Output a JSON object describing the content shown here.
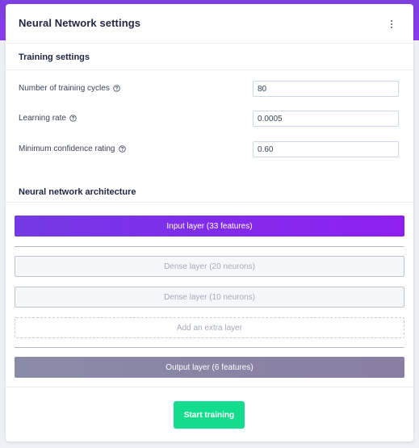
{
  "header": {
    "title": "Neural Network settings",
    "menu_icon": "kebab-menu-icon"
  },
  "training": {
    "title": "Training settings",
    "fields": [
      {
        "label": "Number of training cycles",
        "value": "80",
        "help_icon": "help-circle-icon"
      },
      {
        "label": "Learning rate",
        "value": "0.0005",
        "help_icon": "help-circle-icon"
      },
      {
        "label": "Minimum confidence rating",
        "value": "0.60",
        "help_icon": "help-circle-icon"
      }
    ]
  },
  "architecture": {
    "title": "Neural network architecture",
    "input_layer": "Input layer (33 features)",
    "dense_layers": [
      "Dense layer (20 neurons)",
      "Dense layer (10 neurons)"
    ],
    "add_layer": "Add an extra layer",
    "output_layer": "Output layer (6 features)"
  },
  "actions": {
    "start_training": "Start training"
  },
  "colors": {
    "accent_purple": "#8c3af0",
    "start_button": "#13dc8c",
    "output_layer": "#8a8ba7"
  }
}
